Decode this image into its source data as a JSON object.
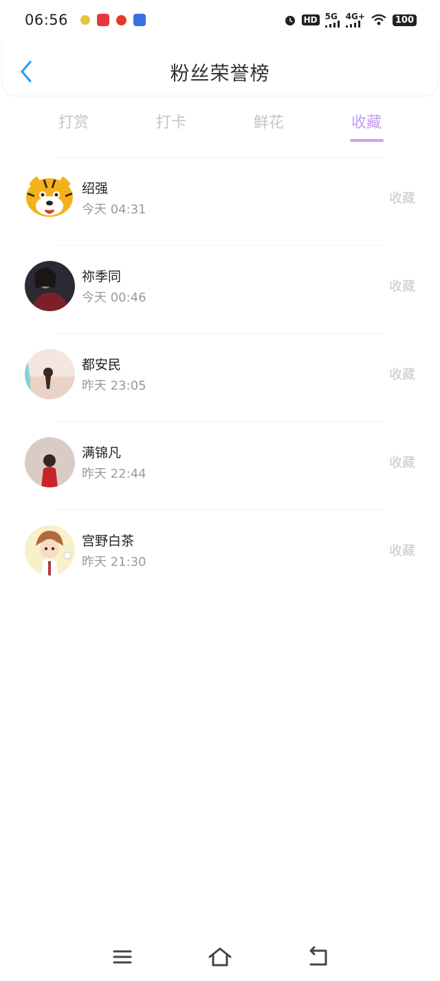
{
  "status_bar": {
    "time": "06:56",
    "hd": "HD",
    "sim_5g": "5G",
    "sim_4g": "4G+",
    "battery": "100",
    "app_icons": [
      "app-icon-green",
      "app-icon-red-badge",
      "app-icon-red-round",
      "app-icon-blue"
    ]
  },
  "header": {
    "title": "粉丝荣誉榜",
    "back_icon": "chevron-left-icon",
    "accent": "#2a9df4"
  },
  "tabs": [
    {
      "label": "打赏",
      "active": false
    },
    {
      "label": "打卡",
      "active": false
    },
    {
      "label": "鲜花",
      "active": false
    },
    {
      "label": "收藏",
      "active": true
    }
  ],
  "tab_active_color": "#c59bf0",
  "fans": [
    {
      "name": "绍强",
      "time": "今天 04:31",
      "action": "收藏",
      "avatar": "tiger-avatar"
    },
    {
      "name": "祢季同",
      "time": "今天 00:46",
      "action": "收藏",
      "avatar": "dark-portrait-avatar"
    },
    {
      "name": "都安民",
      "time": "昨天 23:05",
      "action": "收藏",
      "avatar": "beach-avatar"
    },
    {
      "name": "满锦凡",
      "time": "昨天 22:44",
      "action": "收藏",
      "avatar": "red-coat-avatar"
    },
    {
      "name": "宫野白茶",
      "time": "昨天 21:30",
      "action": "收藏",
      "avatar": "anime-avatar"
    }
  ],
  "nav": {
    "menu_icon": "menu-icon",
    "home_icon": "home-icon",
    "back_icon": "back-arrow-icon"
  }
}
